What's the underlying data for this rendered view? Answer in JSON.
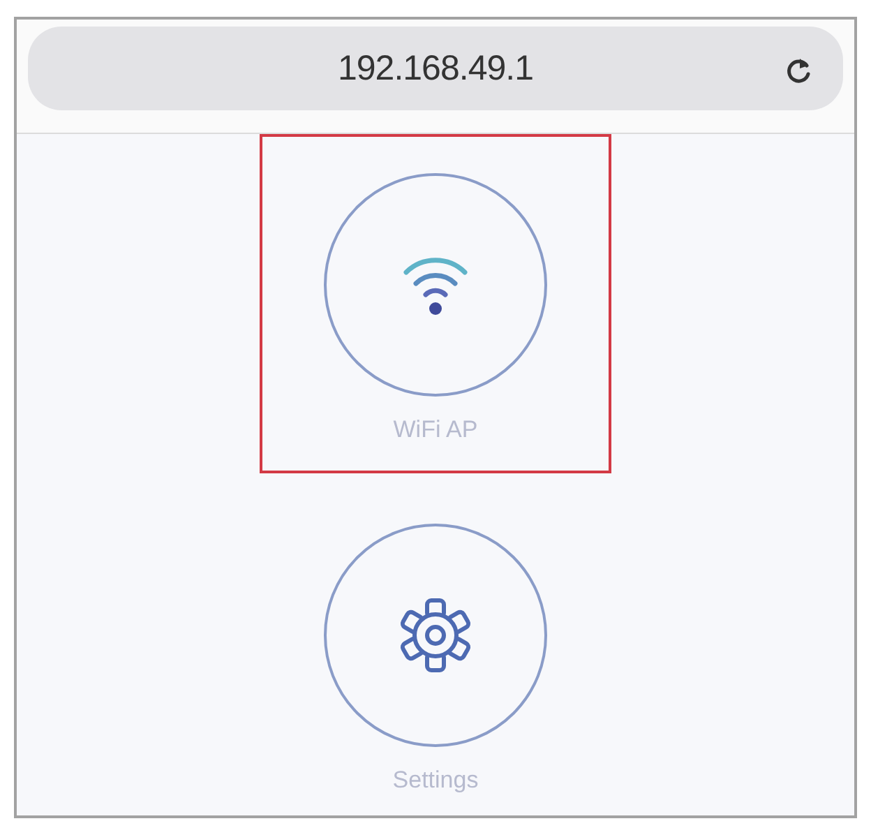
{
  "address_bar": {
    "url": "192.168.49.1"
  },
  "items": [
    {
      "kind": "wifi",
      "label": "WiFi AP",
      "highlighted": true
    },
    {
      "kind": "settings",
      "label": "Settings",
      "highlighted": false
    }
  ]
}
